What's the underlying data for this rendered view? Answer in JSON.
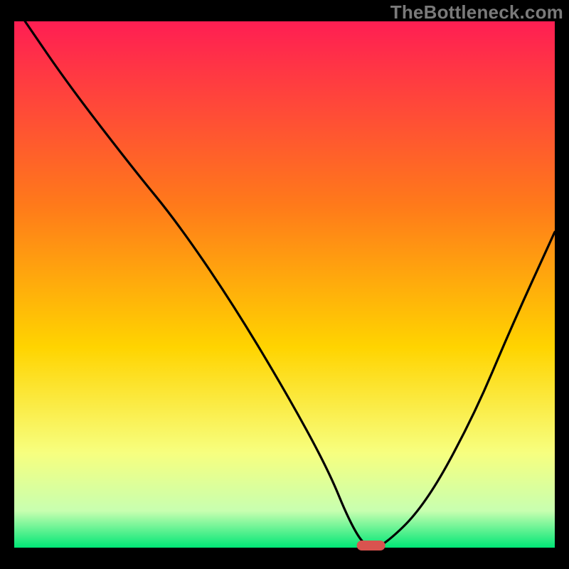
{
  "watermark": "TheBottleneck.com",
  "chart_data": {
    "type": "line",
    "title": "",
    "xlabel": "",
    "ylabel": "",
    "xlim": [
      0,
      100
    ],
    "ylim": [
      0,
      100
    ],
    "x": [
      2,
      10,
      22,
      30,
      40,
      50,
      58,
      62,
      65,
      68,
      76,
      85,
      92,
      100
    ],
    "values": [
      100,
      88,
      72,
      62,
      47,
      30,
      15,
      5,
      0,
      0,
      8,
      25,
      42,
      60
    ],
    "marker": {
      "x": 66,
      "y": 0,
      "color": "#d9534f"
    },
    "background": {
      "top_color": "#ff1e53",
      "mid_color": "#ffd400",
      "low_color": "#f7ff7f",
      "bottom_color": "#00e676"
    }
  }
}
